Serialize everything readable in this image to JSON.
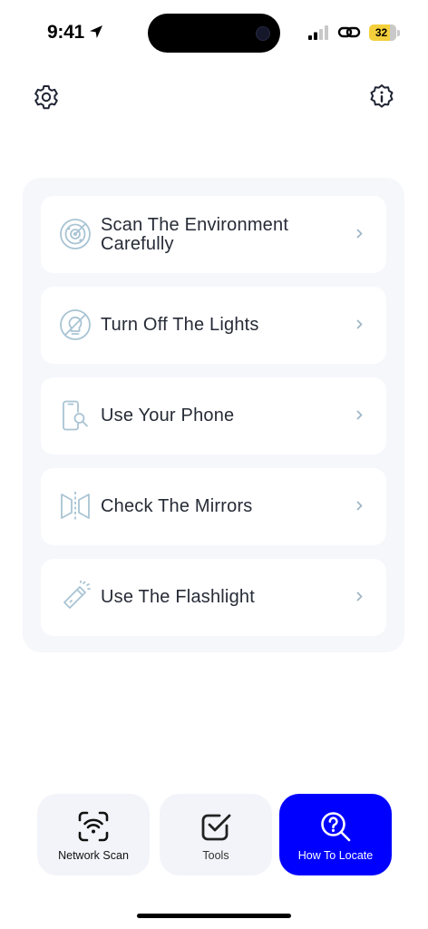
{
  "status_bar": {
    "time": "9:41",
    "battery": "32"
  },
  "guide": {
    "items": [
      {
        "label": "Scan The Environment Carefully",
        "icon": "radar-icon"
      },
      {
        "label": "Turn Off The Lights",
        "icon": "lights-off-icon"
      },
      {
        "label": "Use Your Phone",
        "icon": "phone-search-icon"
      },
      {
        "label": "Check The Mirrors",
        "icon": "mirror-icon"
      },
      {
        "label": "Use The Flashlight",
        "icon": "flashlight-icon"
      }
    ]
  },
  "tab_bar": {
    "tabs": [
      {
        "label": "Network Scan",
        "icon": "wifi-scan-icon",
        "active": false
      },
      {
        "label": "Tools",
        "icon": "checkbox-icon",
        "active": false
      },
      {
        "label": "How To Locate",
        "icon": "search-help-icon",
        "active": true
      }
    ]
  },
  "colors": {
    "accent": "#0000FF",
    "icon_tint": "#a9c4d4",
    "card_bg": "#f5f7fb"
  }
}
